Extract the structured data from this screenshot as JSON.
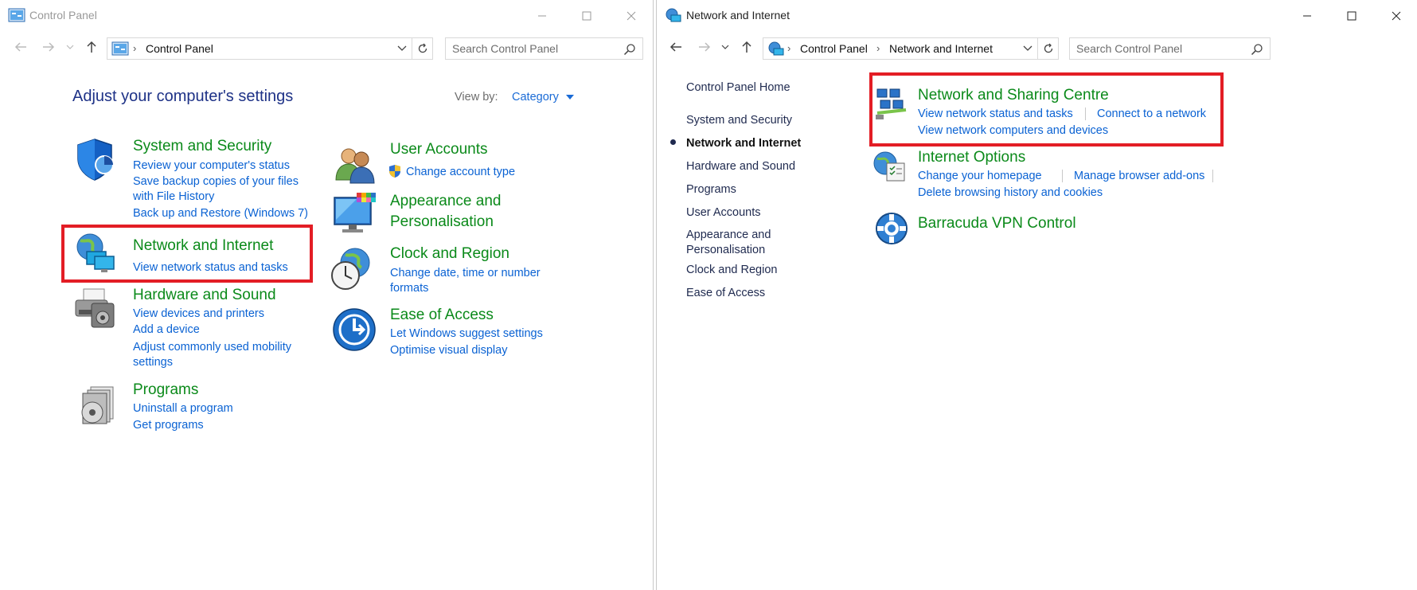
{
  "left": {
    "title": "Control Panel",
    "breadcrumb": "Control Panel",
    "search_placeholder": "Search Control Panel",
    "heading": "Adjust your computer's settings",
    "view_by_label": "View by:",
    "view_by_value": "Category",
    "categories": {
      "system_security": {
        "title": "System and Security",
        "links": [
          "Review your computer's status",
          "Save backup copies of your files",
          "with File History",
          "Back up and Restore (Windows 7)"
        ]
      },
      "network_internet": {
        "title": "Network and Internet",
        "links": [
          "View network status and tasks"
        ]
      },
      "hardware_sound": {
        "title": "Hardware and Sound",
        "links": [
          "View devices and printers",
          "Add a device",
          "Adjust commonly used mobility",
          "settings"
        ]
      },
      "programs": {
        "title": "Programs",
        "links": [
          "Uninstall a program",
          "Get programs"
        ]
      },
      "user_accounts": {
        "title": "User Accounts",
        "links": [
          "Change account type"
        ]
      },
      "appearance": {
        "title_line1": "Appearance and",
        "title_line2": "Personalisation"
      },
      "clock_region": {
        "title": "Clock and Region",
        "links": [
          "Change date, time or number",
          "formats"
        ]
      },
      "ease_access": {
        "title": "Ease of Access",
        "links": [
          "Let Windows suggest settings",
          "Optimise visual display"
        ]
      }
    }
  },
  "right": {
    "title": "Network and Internet",
    "breadcrumb": [
      "Control Panel",
      "Network and Internet"
    ],
    "search_placeholder": "Search Control Panel",
    "sidebar": [
      "Control Panel Home",
      "System and Security",
      "Network and Internet",
      "Hardware and Sound",
      "Programs",
      "User Accounts",
      "Appearance and",
      "Personalisation",
      "Clock and Region",
      "Ease of Access"
    ],
    "sections": {
      "sharing": {
        "title": "Network and Sharing Centre",
        "links": [
          "View network status and tasks",
          "Connect to a network",
          "View network computers and devices"
        ]
      },
      "internet_options": {
        "title": "Internet Options",
        "links": [
          "Change your homepage",
          "Manage browser add-ons",
          "Delete browsing history and cookies"
        ]
      },
      "vpn": {
        "title": "Barracuda VPN Control"
      }
    }
  },
  "colors": {
    "category_title": "#0b8a1a",
    "link": "#0a62d3",
    "highlight": "#e31d25",
    "heading": "#1e3287"
  }
}
